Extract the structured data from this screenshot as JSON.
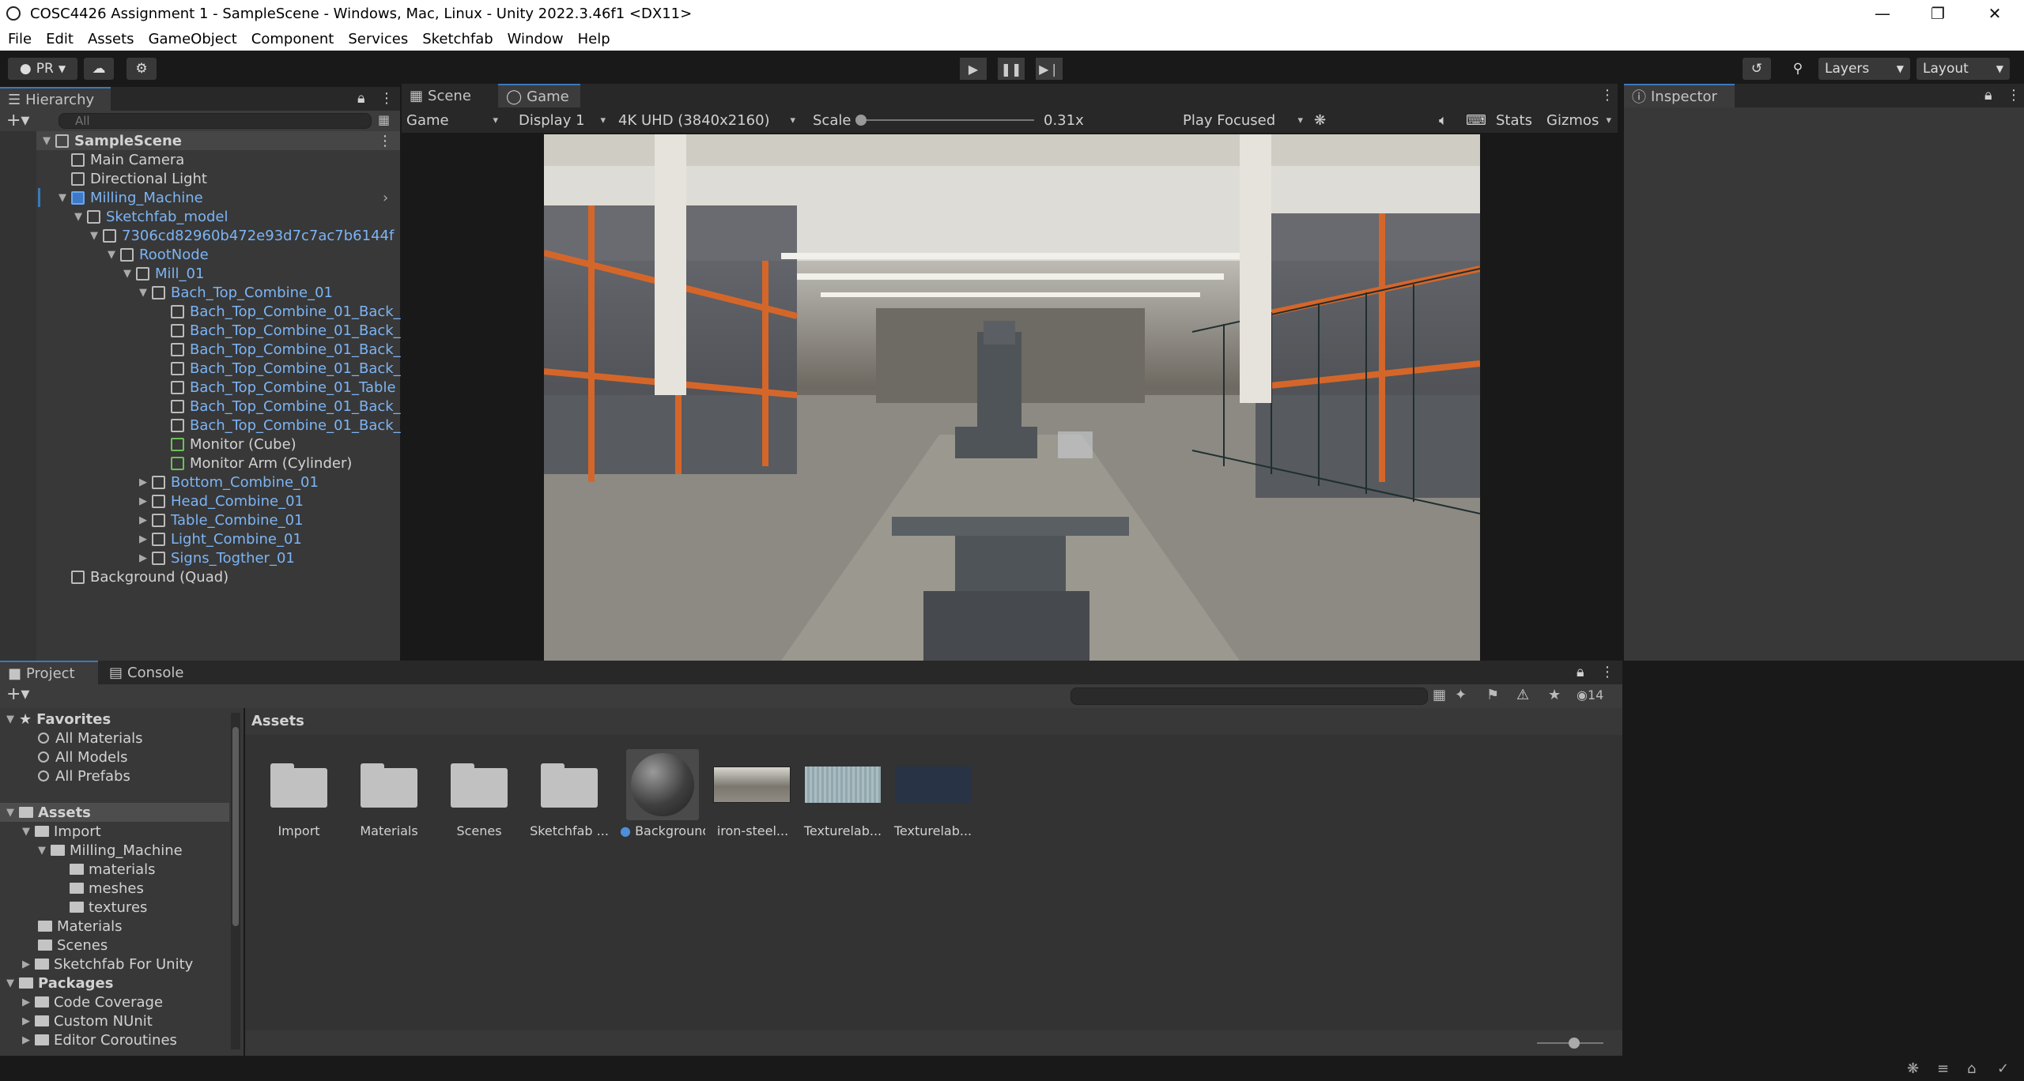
{
  "window": {
    "title": "COSC4426 Assignment 1 - SampleScene - Windows, Mac, Linux - Unity 2022.3.46f1 <DX11>"
  },
  "menu": [
    "File",
    "Edit",
    "Assets",
    "GameObject",
    "Component",
    "Services",
    "Sketchfab",
    "Window",
    "Help"
  ],
  "toolbar": {
    "account": "PR",
    "layers": "Layers",
    "layout": "Layout"
  },
  "hierarchy": {
    "tab": "Hierarchy",
    "search_placeholder": "All",
    "rows": [
      {
        "label": "SampleScene"
      },
      {
        "label": "Main Camera"
      },
      {
        "label": "Directional Light"
      },
      {
        "label": "Milling_Machine"
      },
      {
        "label": "Sketchfab_model"
      },
      {
        "label": "7306cd82960b472e93d7c7ac7b6144f"
      },
      {
        "label": "RootNode"
      },
      {
        "label": "Mill_01"
      },
      {
        "label": "Bach_Top_Combine_01"
      },
      {
        "label": "Bach_Top_Combine_01_Back_"
      },
      {
        "label": "Bach_Top_Combine_01_Back_"
      },
      {
        "label": "Bach_Top_Combine_01_Back_"
      },
      {
        "label": "Bach_Top_Combine_01_Back_"
      },
      {
        "label": "Bach_Top_Combine_01_Table"
      },
      {
        "label": "Bach_Top_Combine_01_Back_"
      },
      {
        "label": "Bach_Top_Combine_01_Back_"
      },
      {
        "label": "Monitor (Cube)"
      },
      {
        "label": "Monitor Arm (Cylinder)"
      },
      {
        "label": "Bottom_Combine_01"
      },
      {
        "label": "Head_Combine_01"
      },
      {
        "label": "Table_Combine_01"
      },
      {
        "label": "Light_Combine_01"
      },
      {
        "label": "Signs_Togther_01"
      },
      {
        "label": "Background (Quad)"
      }
    ]
  },
  "game": {
    "tabs": {
      "scene": "Scene",
      "game": "Game"
    },
    "view": "Game",
    "display": "Display 1",
    "resolution": "4K UHD (3840x2160)",
    "scale_label": "Scale",
    "scale_value": "0.31x",
    "play_mode": "Play Focused",
    "stats": "Stats",
    "gizmos": "Gizmos"
  },
  "inspector": {
    "tab": "Inspector"
  },
  "project": {
    "tabs": {
      "project": "Project",
      "console": "Console"
    },
    "favorites": {
      "title": "Favorites",
      "items": [
        "All Materials",
        "All Models",
        "All Prefabs"
      ]
    },
    "assets_tree": {
      "title": "Assets",
      "import": "Import",
      "milling": "Milling_Machine",
      "sub": [
        "materials",
        "meshes",
        "textures"
      ],
      "others": [
        "Materials",
        "Scenes",
        "Sketchfab For Unity"
      ]
    },
    "packages": {
      "title": "Packages",
      "items": [
        "Code Coverage",
        "Custom NUnit",
        "Editor Coroutines"
      ]
    },
    "breadcrumb": "Assets",
    "hidden_count": "14",
    "assets": [
      {
        "label": "Import"
      },
      {
        "label": "Materials"
      },
      {
        "label": "Scenes"
      },
      {
        "label": "Sketchfab ..."
      },
      {
        "label": "Background"
      },
      {
        "label": "iron-steel..."
      },
      {
        "label": "Texturelab..."
      },
      {
        "label": "Texturelab..."
      }
    ]
  }
}
